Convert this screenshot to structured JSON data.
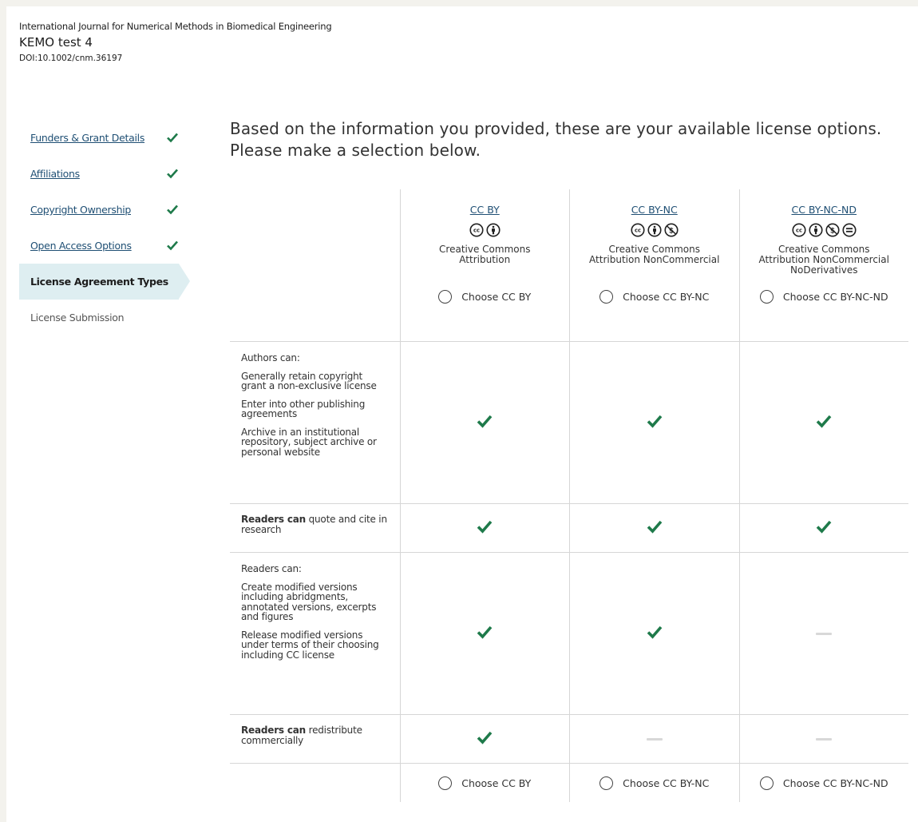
{
  "header": {
    "journal": "International Journal for Numerical Methods in Biomedical Engineering",
    "article_title": "KEMO test 4",
    "doi": "DOI:10.1002/cnm.36197"
  },
  "steps": [
    {
      "label": "Funders & Grant Details",
      "state": "done"
    },
    {
      "label": "Affiliations",
      "state": "done"
    },
    {
      "label": "Copyright Ownership",
      "state": "done"
    },
    {
      "label": "Open Access Options",
      "state": "done"
    },
    {
      "label": "License Agreement Types",
      "state": "active"
    },
    {
      "label": "License Submission",
      "state": "pending"
    }
  ],
  "heading": "Based on the information you provided, these are your available license options. Please make a selection below.",
  "licenses": [
    {
      "name": "CC BY",
      "desc_line1": "Creative Commons",
      "desc_line2": "Attribution",
      "desc_line3": "",
      "choose_label": "Choose CC BY"
    },
    {
      "name": "CC BY-NC",
      "desc_line1": "Creative Commons",
      "desc_line2": "Attribution NonCommercial",
      "desc_line3": "",
      "choose_label": "Choose CC BY-NC"
    },
    {
      "name": "CC BY-NC-ND",
      "desc_line1": "Creative Commons",
      "desc_line2": "Attribution NonCommercial",
      "desc_line3": "NoDerivatives",
      "choose_label": "Choose CC BY-NC-ND"
    }
  ],
  "rows": {
    "authors": {
      "title": "Authors can:",
      "item1": "Generally retain copyright grant a non-exclusive license",
      "item2": "Enter into other publishing agreements",
      "item3": "Archive in an institutional repository, subject archive or personal website"
    },
    "quote": {
      "bold": "Readers can",
      "rest": " quote and cite in research"
    },
    "modify": {
      "title": "Readers can:",
      "item1": "Create modified versions including abridgments, annotated versions, excerpts and figures",
      "item2": "Release modified versions under terms of their choosing including CC license"
    },
    "commercial": {
      "bold": "Readers can",
      "rest": " redistribute commercially"
    }
  },
  "availability": {
    "authors": [
      "check",
      "check",
      "check"
    ],
    "quote": [
      "check",
      "check",
      "check"
    ],
    "modify": [
      "check",
      "check",
      "dash"
    ],
    "commercial": [
      "check",
      "dash",
      "dash"
    ]
  },
  "colors": {
    "check": "#1e7a4a",
    "link": "#1f4f74",
    "active_step": "#deeef1"
  }
}
